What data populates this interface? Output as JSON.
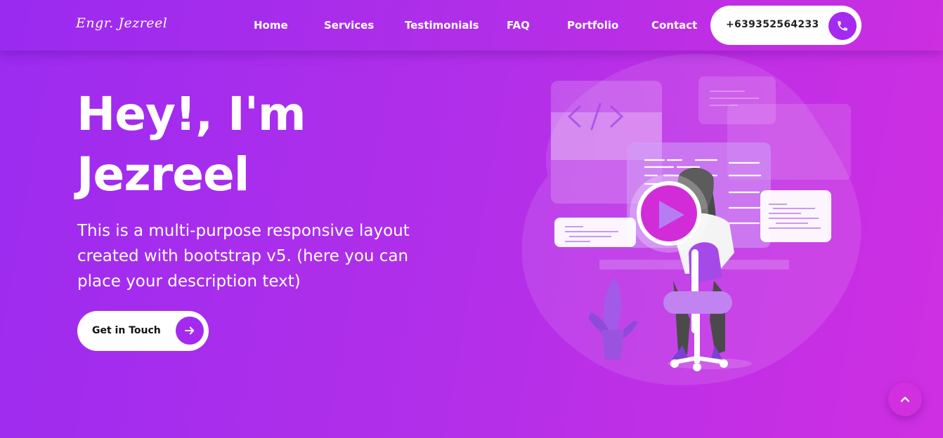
{
  "brand": {
    "name": "Engr. Jezreel"
  },
  "nav": {
    "items": [
      {
        "label": "Home"
      },
      {
        "label": "Services"
      },
      {
        "label": "Testimonials"
      },
      {
        "label": "FAQ"
      },
      {
        "label": "Portfolio"
      },
      {
        "label": "Contact"
      }
    ],
    "phone": "+639352564233"
  },
  "hero": {
    "title_line1": "Hey!, I'm",
    "title_line2": "Jezreel",
    "description": "This is a multi-purpose responsive layout created with bootstrap v5. (here you can place your description text)",
    "cta_label": "Get in Touch"
  },
  "icons": {
    "phone": "phone-icon",
    "cta": "arrow-right-icon",
    "scroll_top": "chevron-up-icon",
    "illustration_play": "play-icon",
    "illustration_code": "code-icon"
  },
  "colors": {
    "accent": "#a42aef",
    "gradient_start": "#9c2bf0",
    "gradient_end": "#cf2fe2"
  }
}
